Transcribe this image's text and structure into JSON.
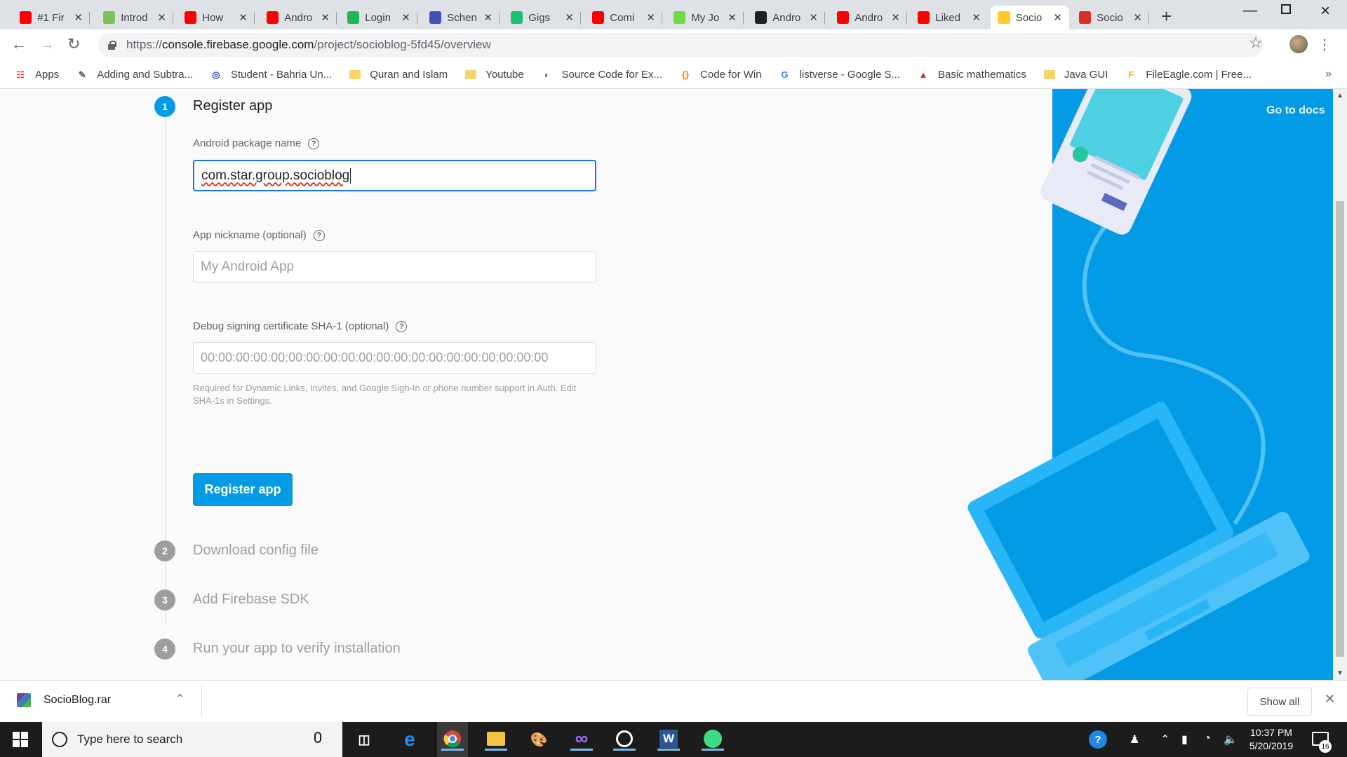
{
  "browser": {
    "tabs": [
      {
        "title": "#1 Fir",
        "icon": "youtube-icon",
        "color": "#ff0000"
      },
      {
        "title": "Introd",
        "icon": "android-icon",
        "color": "#78c257"
      },
      {
        "title": "How",
        "icon": "youtube-icon",
        "color": "#ff0000"
      },
      {
        "title": "Andro",
        "icon": "youtube-icon",
        "color": "#ff0000"
      },
      {
        "title": "Login",
        "icon": "login-icon",
        "color": "#1db954"
      },
      {
        "title": "Schen",
        "icon": "schema-icon",
        "color": "#3f51b5"
      },
      {
        "title": "Gigs",
        "icon": "fiverr-icon",
        "color": "#1dbf73"
      },
      {
        "title": "Comi",
        "icon": "youtube-icon",
        "color": "#ff0000"
      },
      {
        "title": "My Jo",
        "icon": "upwork-icon",
        "color": "#6fda44"
      },
      {
        "title": "Andro",
        "icon": "person-icon",
        "color": "#202124"
      },
      {
        "title": "Andro",
        "icon": "youtube-icon",
        "color": "#ff0000"
      },
      {
        "title": "Liked",
        "icon": "youtube-icon",
        "color": "#ff0000"
      },
      {
        "title": "Socio",
        "icon": "firebase-icon",
        "color": "#ffca28"
      },
      {
        "title": "Socio",
        "icon": "gmail-icon",
        "color": "#d93025"
      }
    ],
    "url_prefix": "https://",
    "url_host": "console.firebase.google.com",
    "url_path": "/project/socioblog-5fd45/overview",
    "bookmarks": [
      {
        "label": "Apps",
        "icon": "apps-grid-icon"
      },
      {
        "label": "Adding and Subtra...",
        "icon": "math-icon"
      },
      {
        "label": "Student - Bahria Un...",
        "icon": "university-icon"
      },
      {
        "label": "Quran and Islam",
        "icon": "folder-icon"
      },
      {
        "label": "Youtube",
        "icon": "folder-icon"
      },
      {
        "label": "Source Code for Ex...",
        "icon": "globe-icon"
      },
      {
        "label": "Code for Win",
        "icon": "braces-icon"
      },
      {
        "label": "listverse - Google S...",
        "icon": "google-icon"
      },
      {
        "label": "Basic mathematics",
        "icon": "triangle-icon"
      },
      {
        "label": "Java GUI",
        "icon": "folder-icon"
      },
      {
        "label": "FileEagle.com | Free...",
        "icon": "fileeagle-icon"
      }
    ],
    "bookmarks_more": "»"
  },
  "firebase": {
    "go_to_docs": "Go to docs",
    "steps": [
      {
        "num": "1",
        "title": "Register app"
      },
      {
        "num": "2",
        "title": "Download config file"
      },
      {
        "num": "3",
        "title": "Add Firebase SDK"
      },
      {
        "num": "4",
        "title": "Run your app to verify installation"
      }
    ],
    "package_label": "Android package name",
    "package_value": "com.star.group.socioblog",
    "nickname_label": "App nickname (optional)",
    "nickname_placeholder": "My Android App",
    "sha_label": "Debug signing certificate SHA-1 (optional)",
    "sha_placeholder": "00:00:00:00:00:00:00:00:00:00:00:00:00:00:00:00:00:00:00:00",
    "sha_hint": "Required for Dynamic Links, Invites, and Google Sign-In or phone number support in Auth. Edit SHA-1s in Settings.",
    "register_button": "Register app",
    "help_glyph": "?"
  },
  "downloads": {
    "file_name": "SocioBlog.rar",
    "show_all": "Show all"
  },
  "taskbar": {
    "search_placeholder": "Type here to search",
    "time": "10:37 PM",
    "date": "5/20/2019",
    "notification_count": "16"
  },
  "colors": {
    "accent": "#039be5",
    "focus": "#1a73e8",
    "illustration_bg": "#039be5"
  }
}
